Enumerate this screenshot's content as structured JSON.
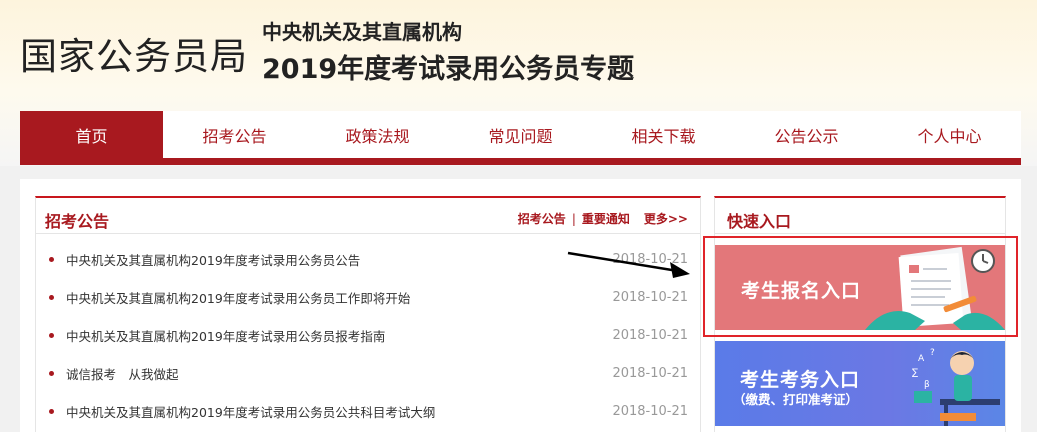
{
  "header": {
    "site_title": "国家公务员局",
    "subtitle_line1": "中央机关及其直属机构",
    "subtitle_line2": "2019年度考试录用公务员专题"
  },
  "nav": {
    "items": [
      {
        "label": "首页",
        "active": true
      },
      {
        "label": "招考公告",
        "active": false
      },
      {
        "label": "政策法规",
        "active": false
      },
      {
        "label": "常见问题",
        "active": false
      },
      {
        "label": "相关下载",
        "active": false
      },
      {
        "label": "公告公示",
        "active": false
      },
      {
        "label": "个人中心",
        "active": false
      }
    ]
  },
  "announcements": {
    "title": "招考公告",
    "link1": "招考公告",
    "separator": "|",
    "link2": "重要通知",
    "more": "更多>>",
    "items": [
      {
        "title": "中央机关及其直属机构2019年度考试录用公务员公告",
        "date": "2018-10-21"
      },
      {
        "title": "中央机关及其直属机构2019年度考试录用公务员工作即将开始",
        "date": "2018-10-21"
      },
      {
        "title": "中央机关及其直属机构2019年度考试录用公务员报考指南",
        "date": "2018-10-21"
      },
      {
        "title": "诚信报考　从我做起",
        "date": "2018-10-21"
      },
      {
        "title": "中央机关及其直属机构2019年度考试录用公务员公共科目考试大纲",
        "date": "2018-10-21"
      }
    ]
  },
  "quick_entry": {
    "title": "快速入口",
    "card1_label": "考生报名入口",
    "card2_label": "考生考务入口",
    "card2_sub": "（缴费、打印准考证）"
  },
  "colors": {
    "brand_red": "#a8191f",
    "highlight_red": "#e0242a",
    "card1_bg": "#e3777a",
    "card2_bg": "#6b78e4"
  }
}
